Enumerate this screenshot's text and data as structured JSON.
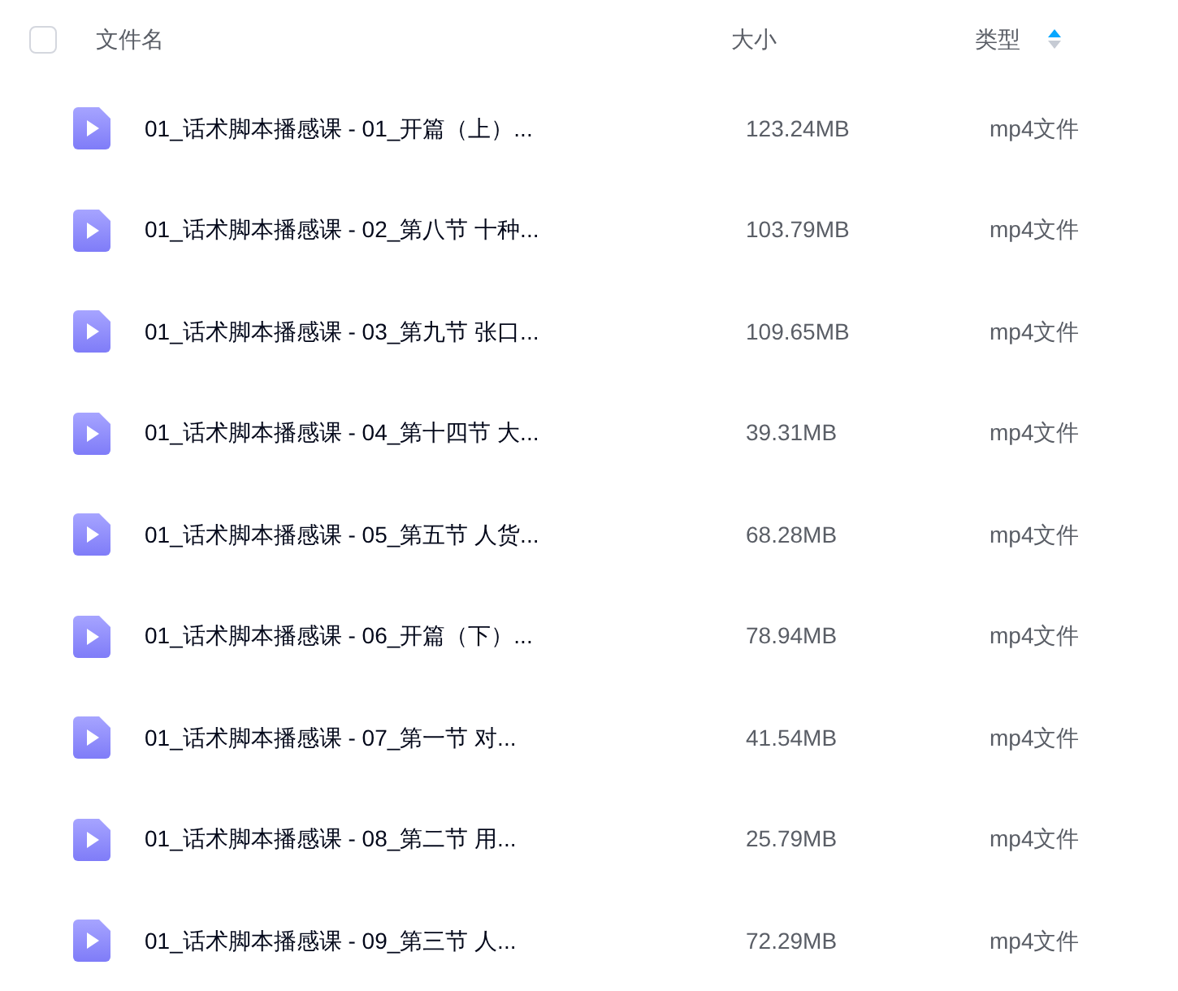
{
  "header": {
    "select_all": {
      "checked": false
    },
    "columns": [
      {
        "label": "文件名",
        "sorted": false
      },
      {
        "label": "大小",
        "sorted": false
      },
      {
        "label": "类型",
        "sorted": true
      }
    ]
  },
  "files": [
    {
      "name": "01_话术脚本播感课 - 01_开篇（上）...",
      "size": "123.24MB",
      "type": "mp4文件"
    },
    {
      "name": "01_话术脚本播感课 - 02_第八节 十种...",
      "size": "103.79MB",
      "type": "mp4文件"
    },
    {
      "name": "01_话术脚本播感课 - 03_第九节 张口...",
      "size": "109.65MB",
      "type": "mp4文件"
    },
    {
      "name": "01_话术脚本播感课 - 04_第十四节 大...",
      "size": "39.31MB",
      "type": "mp4文件"
    },
    {
      "name": "01_话术脚本播感课 - 05_第五节 人货...",
      "size": "68.28MB",
      "type": "mp4文件"
    },
    {
      "name": "01_话术脚本播感课 - 06_开篇（下）...",
      "size": "78.94MB",
      "type": "mp4文件"
    },
    {
      "name": "01_话术脚本播感课 - 07_第一节 对...",
      "size": "41.54MB",
      "type": "mp4文件"
    },
    {
      "name": "01_话术脚本播感课 - 08_第二节 用...",
      "size": "25.79MB",
      "type": "mp4文件"
    },
    {
      "name": "01_话术脚本播感课 - 09_第三节 人...",
      "size": "72.29MB",
      "type": "mp4文件"
    }
  ]
}
